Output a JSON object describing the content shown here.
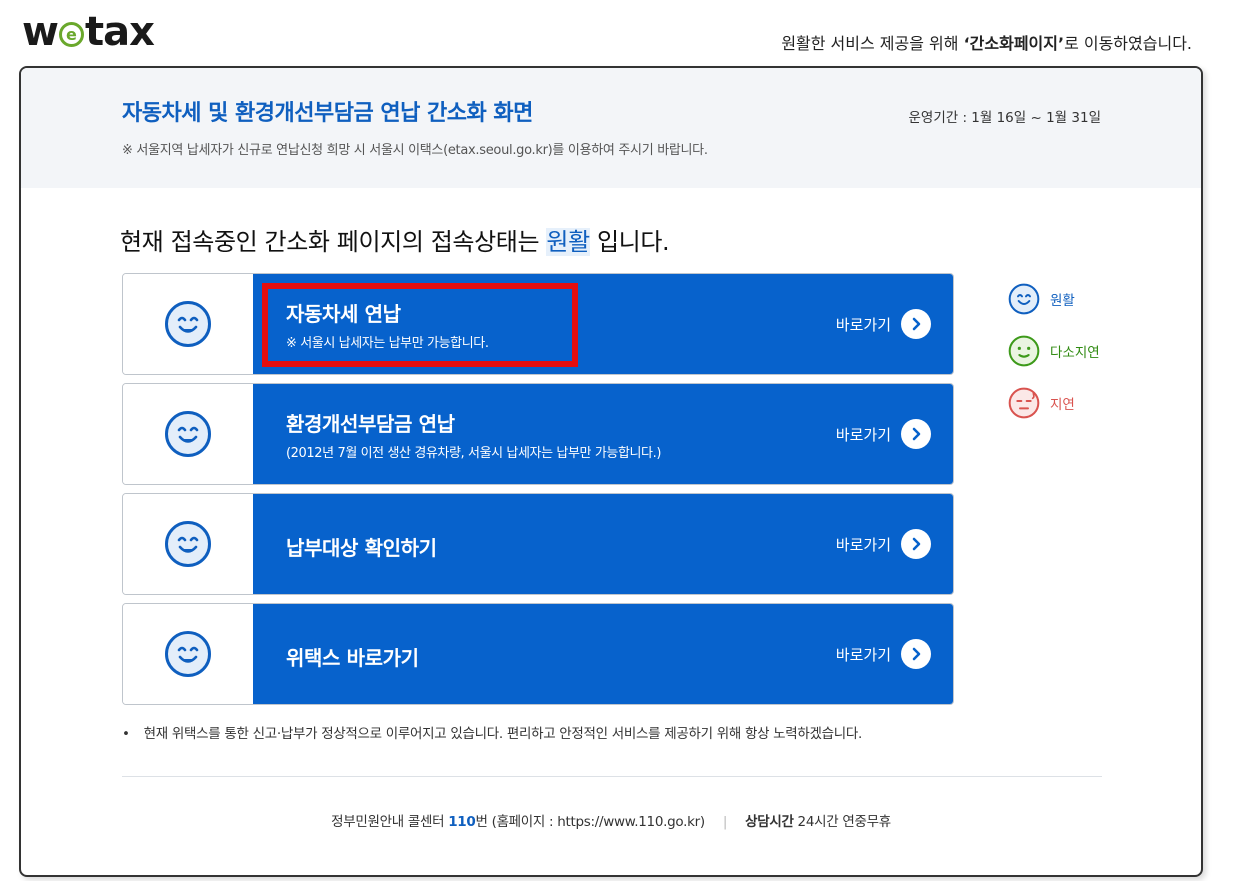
{
  "logo": {
    "prefix": "w",
    "e_letter": "e",
    "suffix": "tax"
  },
  "top_notice": {
    "before": "원활한 서비스 제공을 위해 ",
    "bold": "‘간소화페이지’",
    "after": "로 이동하였습니다."
  },
  "header": {
    "title": "자동차세 및 환경개선부담금 연납 간소화 화면",
    "subtitle": "※ 서울지역 납세자가 신규로 연납신청 희망 시 서울시 이택스(etax.seoul.go.kr)를 이용하여 주시기 바랍니다.",
    "period": "운영기간 : 1월 16일 ~ 1월 31일"
  },
  "status": {
    "before": "현재 접속중인 간소화 페이지의 접속상태는 ",
    "value": "원활",
    "after": " 입니다."
  },
  "rows": [
    {
      "title": "자동차세 연납",
      "desc": "※ 서울시 납세자는 납부만 가능합니다.",
      "go_label": "바로가기",
      "status": "smooth"
    },
    {
      "title": "환경개선부담금 연납",
      "desc": "(2012년 7월 이전 생산 경유차량, 서울시 납세자는 납부만 가능합니다.)",
      "go_label": "바로가기",
      "status": "smooth"
    },
    {
      "title": "납부대상 확인하기",
      "desc": "",
      "go_label": "바로가기",
      "status": "smooth"
    },
    {
      "title": "위택스 바로가기",
      "desc": "",
      "go_label": "바로가기",
      "status": "smooth"
    }
  ],
  "legend": [
    {
      "label": "원활",
      "color": "#0f5fbf",
      "icon": "smile-face-icon"
    },
    {
      "label": "다소지연",
      "color": "#3d9a1a",
      "icon": "neutral-face-icon"
    },
    {
      "label": "지연",
      "color": "#d9534f",
      "icon": "sad-face-icon"
    }
  ],
  "notice": "현재 위택스를 통한 신고·납부가 정상적으로 이루어지고 있습니다. 편리하고 안정적인 서비스를 제공하기 위해 항상 노력하겠습니다.",
  "footer": {
    "call_before": "정부민원안내 콜센터 ",
    "call_number": "110",
    "call_after": "번 (홈페이지 : https://www.110.go.kr)",
    "separator": "|",
    "hours_label": "상담시간",
    "hours_value": " 24시간 연중무휴"
  },
  "colors": {
    "primary": "#0762cc",
    "title_blue": "#0f5fbf",
    "highlight_red": "#e50e0e"
  }
}
